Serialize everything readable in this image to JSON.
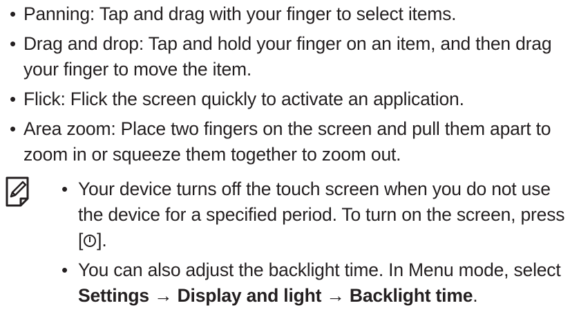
{
  "bullets": [
    {
      "text": "Panning: Tap and drag with your finger to select items."
    },
    {
      "text": "Drag and drop: Tap and hold your finger on an item, and then drag your finger to move the item."
    },
    {
      "text": "Flick: Flick the screen quickly to activate an application."
    },
    {
      "text": "Area zoom: Place two fingers on the screen and pull them apart to zoom in or squeeze them together to zoom out."
    }
  ],
  "note": {
    "icon": "note-pencil-icon",
    "items": [
      {
        "text_before": "Your device turns off the touch screen when you do not use the device for a specified period. To turn on the screen, press [",
        "key_icon": "power-key-icon",
        "text_after": "]."
      },
      {
        "text_before": "You can also adjust the backlight time. In Menu mode, select ",
        "path": {
          "step1": "Settings",
          "arrow1": "→",
          "step2": "Display and light",
          "arrow2": "→",
          "step3": "Backlight time"
        },
        "text_after": "."
      }
    ]
  },
  "bullet_symbol": "•"
}
